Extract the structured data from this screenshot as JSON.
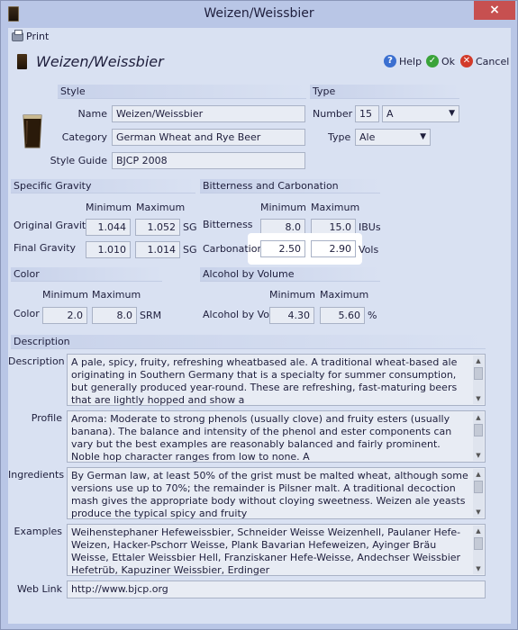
{
  "window": {
    "title": "Weizen/Weissbier",
    "close": "×"
  },
  "toolbar": {
    "print": "Print"
  },
  "header": {
    "title": "Weizen/Weissbier",
    "help": "Help",
    "ok": "Ok",
    "cancel": "Cancel"
  },
  "style": {
    "heading": "Style",
    "name_label": "Name",
    "name": "Weizen/Weissbier",
    "category_label": "Category",
    "category": "German Wheat and Rye Beer",
    "guide_label": "Style Guide",
    "guide": "BJCP 2008"
  },
  "type": {
    "heading": "Type",
    "number_label": "Number",
    "number": "15",
    "letter": "A",
    "type_label": "Type",
    "type": "Ale"
  },
  "gravity": {
    "heading": "Specific Gravity",
    "min_label": "Minimum",
    "max_label": "Maximum",
    "og_label": "Original Gravity",
    "og_min": "1.044",
    "og_max": "1.052",
    "og_unit": "SG",
    "fg_label": "Final Gravity",
    "fg_min": "1.010",
    "fg_max": "1.014",
    "fg_unit": "SG"
  },
  "bitterness": {
    "heading": "Bitterness and Carbonation",
    "min_label": "Minimum",
    "max_label": "Maximum",
    "bit_label": "Bitterness",
    "bit_min": "8.0",
    "bit_max": "15.0",
    "bit_unit": "IBUs",
    "carb_label": "Carbonation",
    "carb_min": "2.50",
    "carb_max": "2.90",
    "carb_unit": "Vols"
  },
  "color": {
    "heading": "Color",
    "min_label": "Minimum",
    "max_label": "Maximum",
    "label": "Color",
    "min": "2.0",
    "max": "8.0",
    "unit": "SRM"
  },
  "abv": {
    "heading": "Alcohol by Volume",
    "min_label": "Minimum",
    "max_label": "Maximum",
    "label": "Alcohol by Vol",
    "min": "4.30",
    "max": "5.60",
    "unit": "%"
  },
  "description": {
    "heading": "Description",
    "desc_label": "Description",
    "desc": "A pale, spicy, fruity, refreshing wheatbased ale. A traditional wheat-based ale originating in Southern Germany that is a specialty for summer consumption, but generally produced year-round. These are refreshing, fast-maturing beers that are lightly hopped and show a",
    "profile_label": "Profile",
    "profile": "Aroma: Moderate to strong phenols (usually clove) and fruity esters (usually banana). The balance and intensity of the phenol and ester components can vary but the best examples are reasonably balanced and fairly prominent. Noble hop character ranges from low to none. A",
    "ingredients_label": "Ingredients",
    "ingredients": "By German law, at least 50% of the grist must be malted wheat, although some versions use up to 70%; the remainder is Pilsner malt. A traditional decoction mash gives the appropriate body without cloying sweetness. Weizen ale yeasts produce the typical spicy and fruity",
    "examples_label": "Examples",
    "examples": "Weihenstephaner Hefeweissbier, Schneider Weisse Weizenhell, Paulaner Hefe-Weizen, Hacker-Pschorr Weisse, Plank Bavarian Hefeweizen, Ayinger Bräu Weisse, Ettaler Weissbier Hell, Franziskaner Hefe-Weisse, Andechser Weissbier Hefetrüb, Kapuziner Weissbier, Erdinger",
    "weblink_label": "Web Link",
    "weblink": "http://www.bjcp.org"
  }
}
